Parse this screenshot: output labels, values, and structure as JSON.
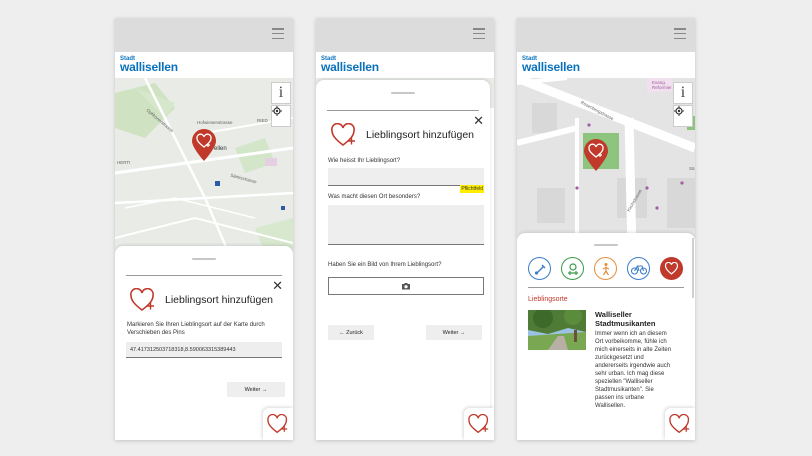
{
  "logo": {
    "small": "Stadt",
    "main": "wallisellen"
  },
  "screen1": {
    "map_labels": [
      "Hofwiesenstrasse",
      "Opfikonerstrasse",
      "HERTI",
      "Säntisstrasse",
      "ellen",
      "RIED"
    ],
    "info_btn": "i",
    "title": "Lieblingsort hinzufügen",
    "instruction": "Markieren Sie Ihren Lieblingsort auf der Karte durch Verschieben des Pins",
    "coords": "47.417312503718318,8.590063315389443",
    "next_button": "Weiter →",
    "close": "✕"
  },
  "screen2": {
    "title": "Lieblingsort hinzufügen",
    "q_name": "Wie heisst Ihr Lieblingsort?",
    "required_badge": "Pflichtfeld",
    "q_special": "Was macht diesen Ort besonders?",
    "q_photo": "Haben Sie ein Bild von Ihrem Lieblingsort?",
    "back_button": "← Zurück",
    "next_button": "Weiter →",
    "close": "✕"
  },
  "screen3": {
    "map_labels": [
      "Rosenbergstrasse",
      "Kirchstrasse",
      "Evang. Reformier",
      "Sä"
    ],
    "info_btn": "i",
    "section_title": "Lieblingsorte",
    "story_title": "Walliseller Stadtmusikanten",
    "story_text": "Immer wenn ich an diesem Ort vorbeikomme, fühle ich mich einerseits in alte Zeiten zurückgesetzt und andererseits irgendwie auch sehr urban. Ich mag diese speziellen \"Walliseller Stadtmusikanten\". Sie passen ins urbane Wallisellen.",
    "categories": [
      "music-icon",
      "park-bench-icon",
      "walking-icon",
      "bicycle-icon",
      "heart-icon"
    ]
  },
  "colors": {
    "accent": "#c0392b",
    "brand": "#0a72bd",
    "map_bg": "#e9ece8"
  }
}
